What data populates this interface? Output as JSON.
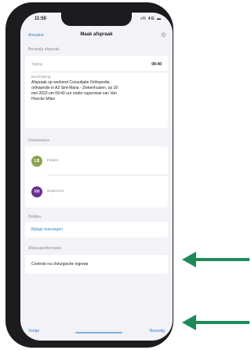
{
  "status_bar": {
    "time": "11:50",
    "icons": "ıll 4G ▬"
  },
  "navbar": {
    "back_label": "Annuleer",
    "title": "Maak afspraak"
  },
  "section_booking": {
    "header": "Bevestig afspraak"
  },
  "time_row": {
    "label": "Tijdstip",
    "value": "09:40"
  },
  "description": {
    "label": "Beschrijving",
    "lines": [
      "Afspraak op werkend Consultatie Orthopedie,",
      "orthopedie in AZ Sint-Maria - Ziekenhuizen, op 18",
      "mei 2023 om 09:40 uur onder supervisie van Van",
      "Hoecke Miles"
    ]
  },
  "participants": {
    "header": "Deelnemers",
    "items": [
      {
        "initials": "LB",
        "name": "Patiënt",
        "color": "#8aa34c"
      },
      {
        "initials": "VH",
        "name": "Supervisor",
        "color": "#6a2f8f"
      }
    ]
  },
  "notes": {
    "header": "Notities",
    "link": "Bijlage toevoegen"
  },
  "reason": {
    "header": "Afspraakinformatie",
    "value": "Controle na chirurgische ingreep"
  },
  "bottom": {
    "left_label": "Vorige",
    "right_label": "Bevestig"
  },
  "colors": {
    "accent": "#3b82c4",
    "arrow": "#1e8a5a"
  }
}
